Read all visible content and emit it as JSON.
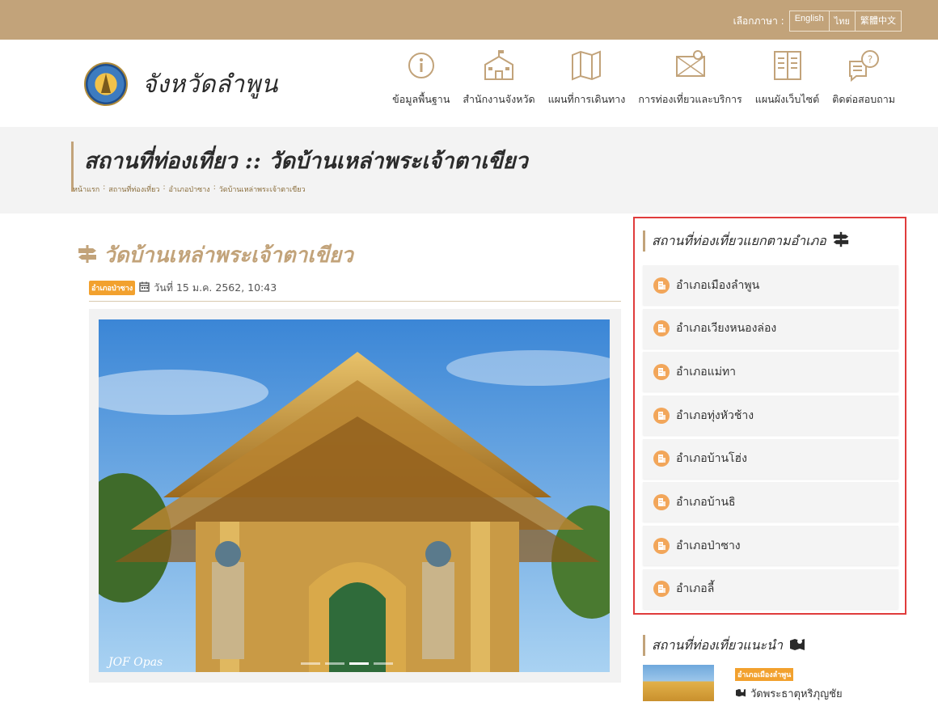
{
  "topbar": {
    "lang_label": "เลือกภาษา :",
    "languages": [
      "English",
      "ไทย",
      "繁體中文"
    ]
  },
  "header": {
    "site_name": "จังหวัดลำพูน",
    "nav": [
      {
        "label": "ข้อมูลพื้นฐาน",
        "icon": "info-icon"
      },
      {
        "label": "สำนักงานจังหวัด",
        "icon": "office-building-icon"
      },
      {
        "label": "แผนที่การเดินทาง",
        "icon": "map-icon"
      },
      {
        "label": "การท่องเที่ยวและบริการ",
        "icon": "location-map-icon"
      },
      {
        "label": "แผนผังเว็บไซต์",
        "icon": "sitemap-book-icon"
      },
      {
        "label": "ติดต่อสอบถาม",
        "icon": "chat-question-icon"
      }
    ]
  },
  "page": {
    "title": "สถานที่ท่องเที่ยว :: วัดบ้านเหล่าพระเจ้าตาเขียว",
    "breadcrumb": [
      "หน้าแรก",
      ":",
      "สถานที่ท่องเที่ยว",
      ":",
      "อำเภอป่าซาง",
      ":",
      "วัดบ้านเหล่าพระเจ้าตาเขียว"
    ]
  },
  "article": {
    "title": "วัดบ้านเหล่าพระเจ้าตาเขียว",
    "district_badge": "อำเภอป่าซาง",
    "date": "วันที่ 15 ม.ค. 2562, 10:43",
    "photo_watermark": "JOF Opas"
  },
  "sidebar": {
    "districts_title": "สถานที่ท่องเที่ยวแยกตามอำเภอ",
    "districts": [
      "อำเภอเมืองลำพูน",
      "อำเภอเวียงหนองล่อง",
      "อำเภอแม่ทา",
      "อำเภอทุ่งหัวช้าง",
      "อำเภอบ้านโฮ่ง",
      "อำเภอบ้านธิ",
      "อำเภอป่าซาง",
      "อำเภอลี้"
    ],
    "recommended_title": "สถานที่ท่องเที่ยวแนะนำ",
    "recommended": {
      "badge": "อำเภอเมืองลำพูน",
      "name": "วัดพระธาตุหริภุญชัย"
    }
  },
  "colors": {
    "gold": "#c2a37a",
    "orange_badge": "#f2a12e",
    "highlight_border": "#e03c3c"
  }
}
